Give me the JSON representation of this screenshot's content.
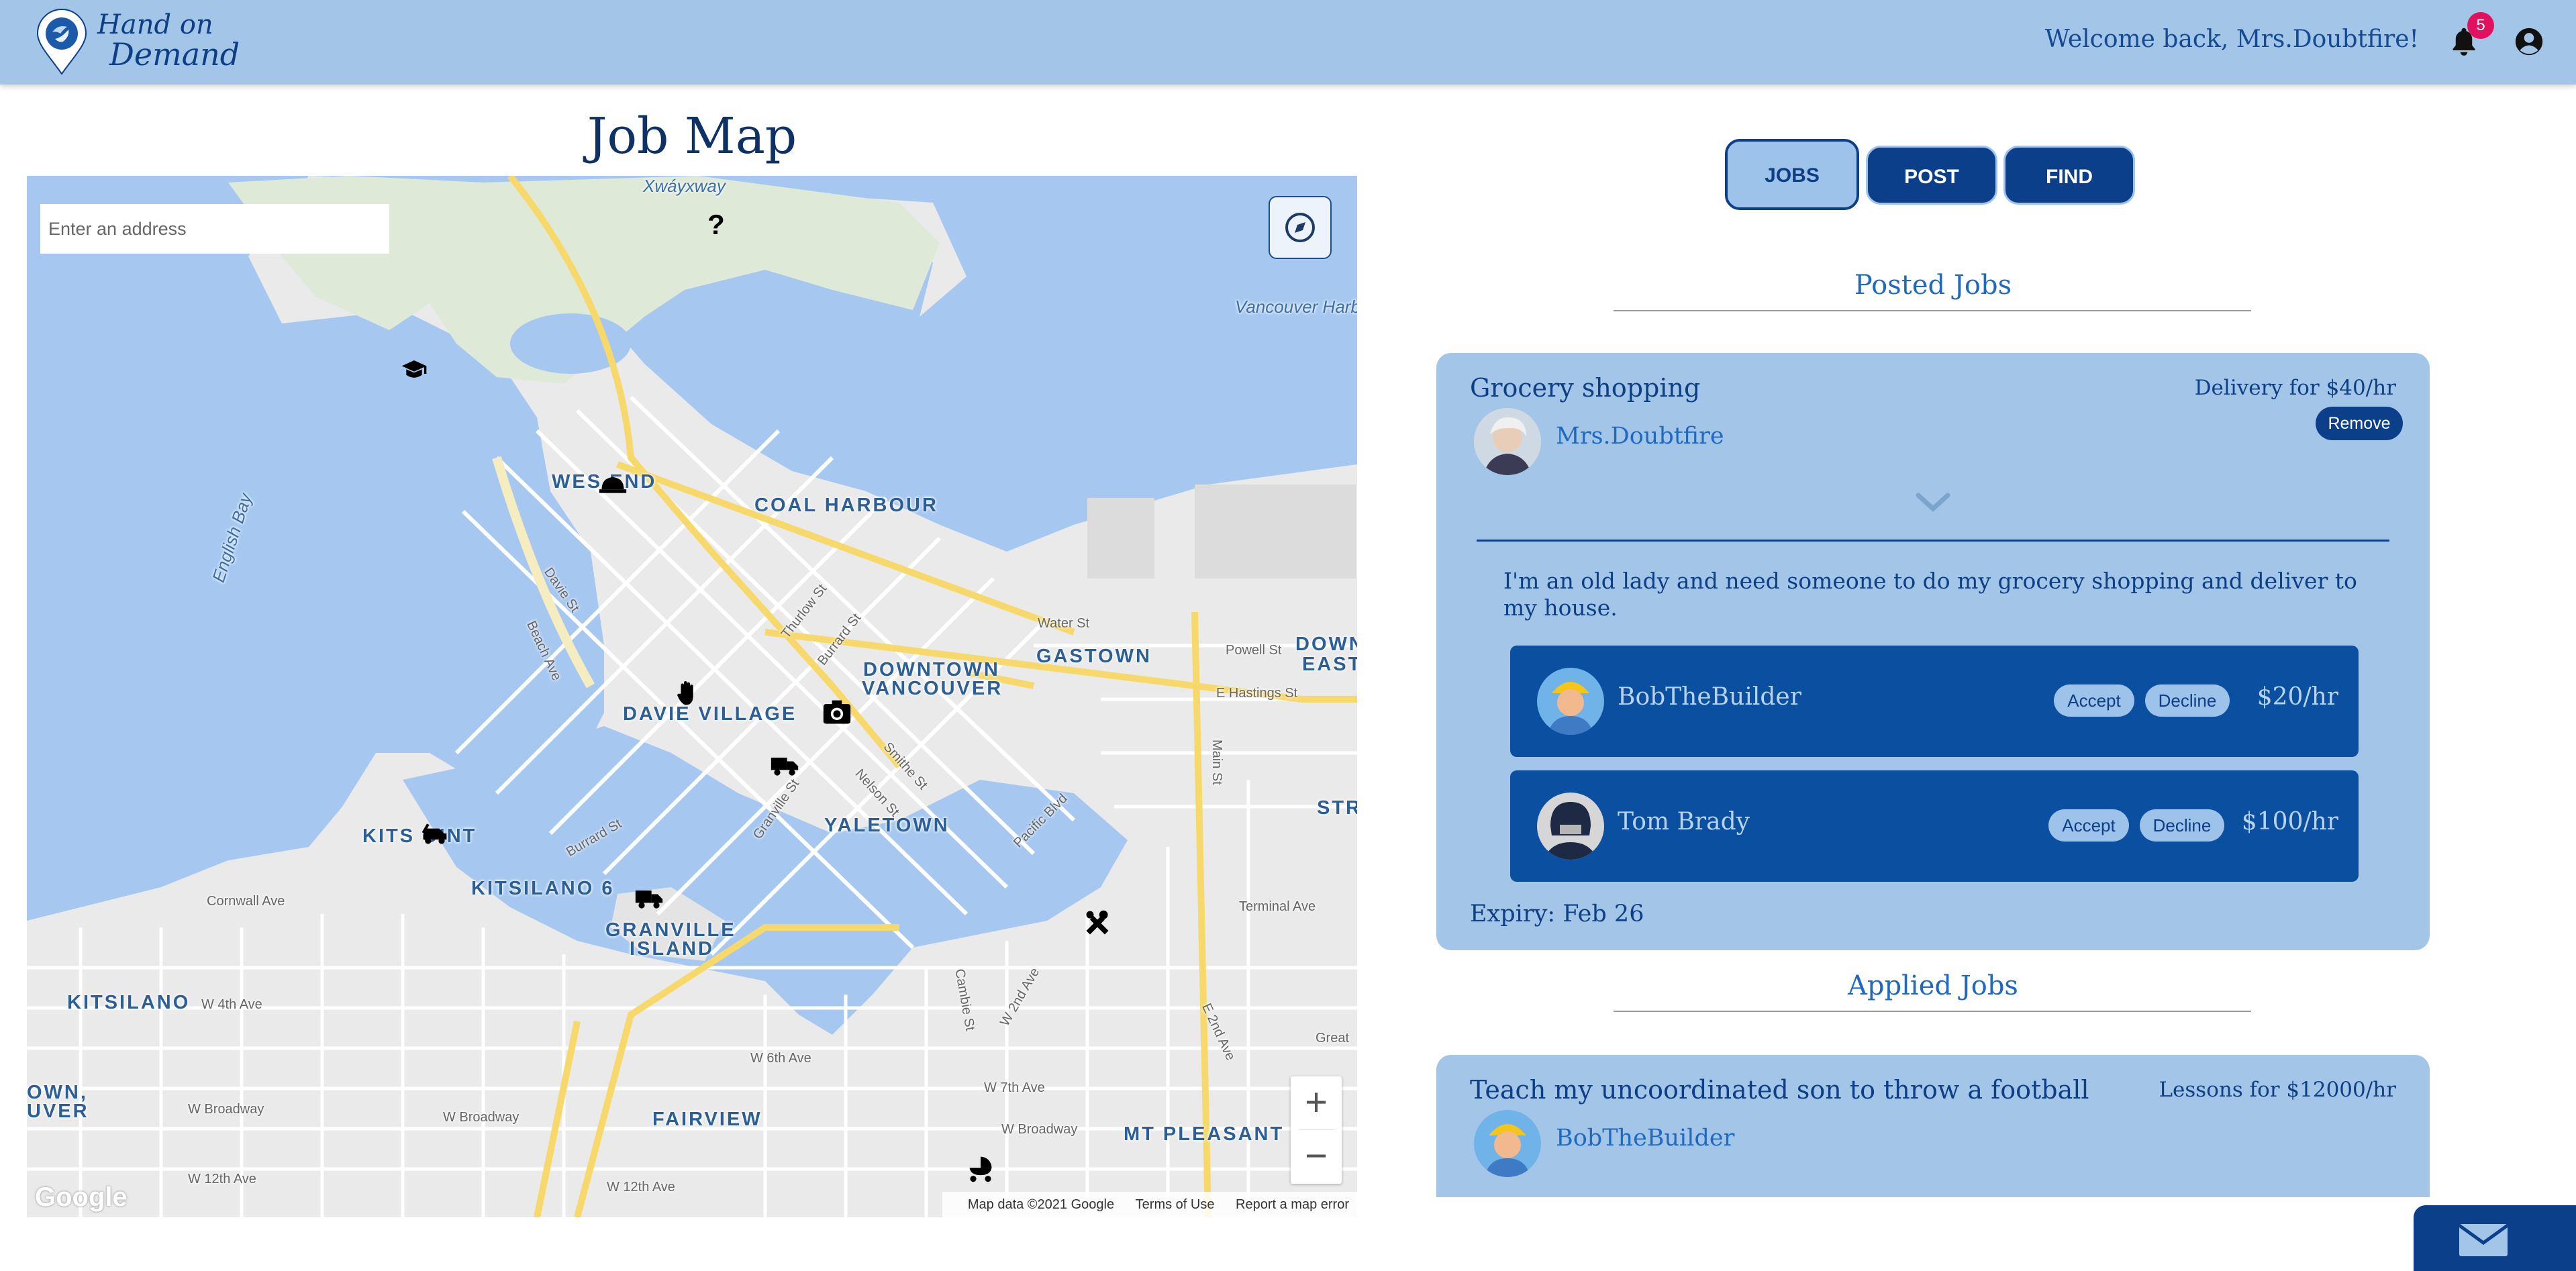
{
  "header": {
    "logo_line1": "Hand on",
    "logo_line2": "Demand",
    "welcome": "Welcome back, Mrs.Doubtfire!",
    "notification_count": "5",
    "colors": {
      "bar": "#a3c6e8",
      "brand": "#0d3f86",
      "badge": "#e0115f"
    }
  },
  "map_panel": {
    "title": "Job Map",
    "search_placeholder": "Enter an address",
    "labels": {
      "west_end": "WES  END",
      "coal_harbour": "COAL HARBOUR",
      "gastown": "GASTOWN",
      "downtown": "DOWNTOWN",
      "vancouver": "VANCOUVER",
      "davie_village": "DAVIE VILLAGE",
      "yaletown": "YALETOWN",
      "kits_point": "KITS  OINT",
      "kitsilano_6": "KITSILANO 6",
      "granville": "GRANVILLE",
      "island": "ISLAND",
      "kitsilano": "KITSILANO",
      "fairview": "FAIRVIEW",
      "mt_pleasant": "MT PLEASANT",
      "down_east": "DOWN",
      "east": "EAST",
      "str": "STR",
      "own": "OWN,",
      "uver": "UVER",
      "xway": "Xwáyxway",
      "english_bay": "English Bay",
      "vancouver_harb": "Vancouver Harb",
      "water_st": "Water St",
      "powell_st": "Powell St",
      "e_hastings": "E Hastings St",
      "main_st": "Main St",
      "terminal_ave": "Terminal Ave",
      "cornwall": "Cornwall Ave",
      "w4th": "W 4th Ave",
      "w6th": "W 6th Ave",
      "w7th": "W 7th Ave",
      "w_broadway": "W Broadway",
      "w_broadway2": "W Broadway",
      "w_broadway3": "W Broadway",
      "w12th": "W 12th Ave",
      "w12th_2": "W 12th Ave",
      "e2nd": "E 2nd Ave",
      "great": "Great",
      "davie_st": "Davie St",
      "beach_ave": "Beach Ave",
      "thurlow": "Thurlow St",
      "burrard": "Burrard St",
      "smithe": "Smithe St",
      "nelson": "Nelson St",
      "granville_st": "Granville St",
      "pacific": "Pacific Blvd",
      "burrard2": "Burrard St",
      "cambie": "Cambie St",
      "w2nd": "W 2nd Ave"
    },
    "footer": {
      "map_data": "Map data ©2021 Google",
      "terms": "Terms of Use",
      "report": "Report a map error"
    },
    "google": "Google",
    "zoom_in": "+",
    "zoom_out": "−",
    "markers": [
      "question-icon",
      "graduation-cap-icon",
      "hard-hat-icon",
      "hand-icon",
      "camera-icon",
      "truck-icon",
      "car-icon",
      "truck-icon",
      "tools-icon",
      "stroller-icon"
    ]
  },
  "tabs": {
    "jobs": "JOBS",
    "post": "POST",
    "find": "FIND"
  },
  "posted": {
    "section_title": "Posted Jobs",
    "job": {
      "title": "Grocery shopping",
      "price": "Delivery for $40/hr",
      "poster": "Mrs.Doubtfire",
      "remove": "Remove",
      "description": "I'm an old lady and need someone to do my grocery shopping and deliver to my house.",
      "expiry": "Expiry: Feb 26",
      "applicants": [
        {
          "name": "BobTheBuilder",
          "accept": "Accept",
          "decline": "Decline",
          "rate": "$20/hr"
        },
        {
          "name": "Tom Brady",
          "accept": "Accept",
          "decline": "Decline",
          "rate": "$100/hr"
        }
      ]
    }
  },
  "applied": {
    "section_title": "Applied Jobs",
    "job": {
      "title": "Teach my uncoordinated son to throw a football",
      "price": "Lessons for $12000/hr",
      "poster": "BobTheBuilder"
    }
  }
}
